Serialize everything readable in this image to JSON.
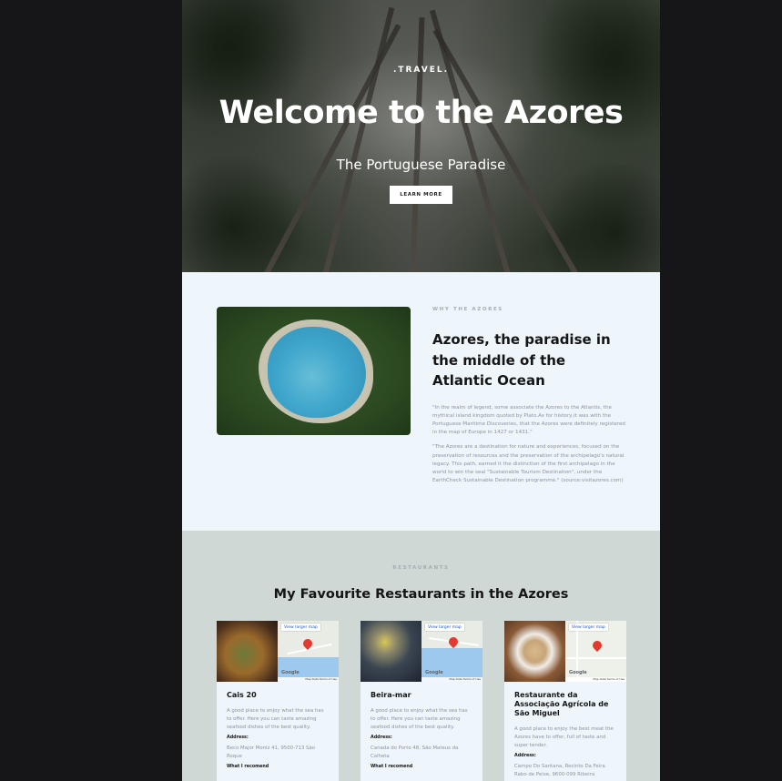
{
  "hero": {
    "tag": ".TRAVEL.",
    "title": "Welcome to the Azores",
    "subtitle": "The Portuguese Paradise",
    "button_label": "LEARN MORE"
  },
  "why": {
    "kicker": "WHY THE AZORES",
    "title": "Azores, the paradise in the middle of the Atlantic Ocean",
    "paragraph_1": "\"In the realm of legend, some associate the Azores to the Atlantis, the mythical island kingdom quoted by Plato.As for history,it was with the Portuguese Maritime Discoveries, that the Azores were definitely registered in the map of Europe in 1427 or 1431.\"",
    "paragraph_2": "\"The Azores are a destination for nature and experiences, focused on the preservation of resources and the preservation of the archipelago's natural legacy. This path, earned it the distinction of the first archipelago in the world to win the seal \"Sustainable Tourism Destination\", under the EarthCheck Sustainable Destination programme.\" (source:visitazores.com)"
  },
  "restaurants": {
    "kicker": "RESTAURANTS",
    "title": "My Favourite Restaurants in the Azores",
    "map_link_label": "View larger map",
    "map_brand": "Google",
    "map_footer": "Map Data   Terms of Use",
    "address_label": "Address:",
    "recommend_label": "What I recomend",
    "cards": [
      {
        "name": "Cais 20",
        "description": "A good place to enjoy what the sea has to offer. Here you can taste amazing seafood dishes of the best quality.",
        "address": "Beco Major Moniz 41, 9500-713 São Roque"
      },
      {
        "name": "Beira-mar",
        "description": "A good place to enjoy what the sea has to offer. Here you can taste amazing seafood dishes of the best quality.",
        "address": "Canada do Porto 48, São Mateus da Calheta"
      },
      {
        "name": "Restaurante da Associação Agrícola de São Miguel",
        "description": "A good place to enjoy the best meat the Azores have to offer, full of taste and super tender.",
        "address": "Campo Do Santana, Recinto Da Feira Rabo de Peixe, 9600-099 Ribeira"
      }
    ]
  }
}
